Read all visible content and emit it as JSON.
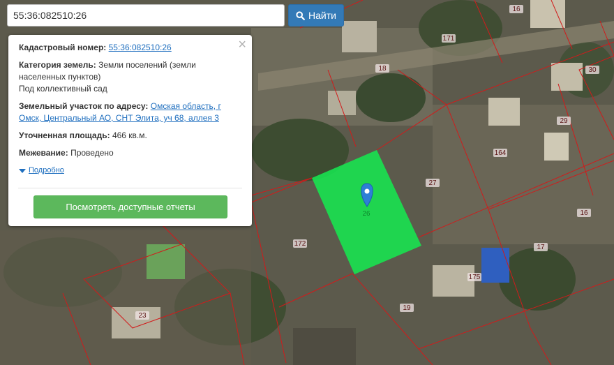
{
  "search": {
    "value": "55:36:082510:26",
    "button_label": "Найти"
  },
  "info": {
    "cadastral_label": "Кадастровый номер:",
    "cadastral_value": "55:36:082510:26",
    "category_label": "Категория земель:",
    "category_line1": "Земли поселений (земли",
    "category_line2": "населенных пунктов)",
    "category_line3": "Под коллективный сад",
    "address_label": "Земельный участок по адресу:",
    "address_line1": "Омская область, г",
    "address_line2": "Омск, Центральный АО, СНТ Элита, уч 68, аллея 3",
    "area_label": "Уточненная площадь:",
    "area_value": "466 кв.м.",
    "survey_label": "Межевание:",
    "survey_value": "Проведено",
    "more_label": "Подробно",
    "reports_button": "Посмотреть доступные отчеты",
    "close_glyph": "×"
  },
  "map": {
    "parcel_labels": [
      "16",
      "171",
      "18",
      "30",
      "29",
      "164",
      "27",
      "16",
      "17",
      "172",
      "175",
      "19",
      "23"
    ],
    "selected_parcel_label": "26",
    "colors": {
      "selected_parcel": "#17e650",
      "boundary": "#d11b1b",
      "marker": "#2e7fd6",
      "button_blue": "#337ab7",
      "button_green": "#5cb85c"
    }
  }
}
